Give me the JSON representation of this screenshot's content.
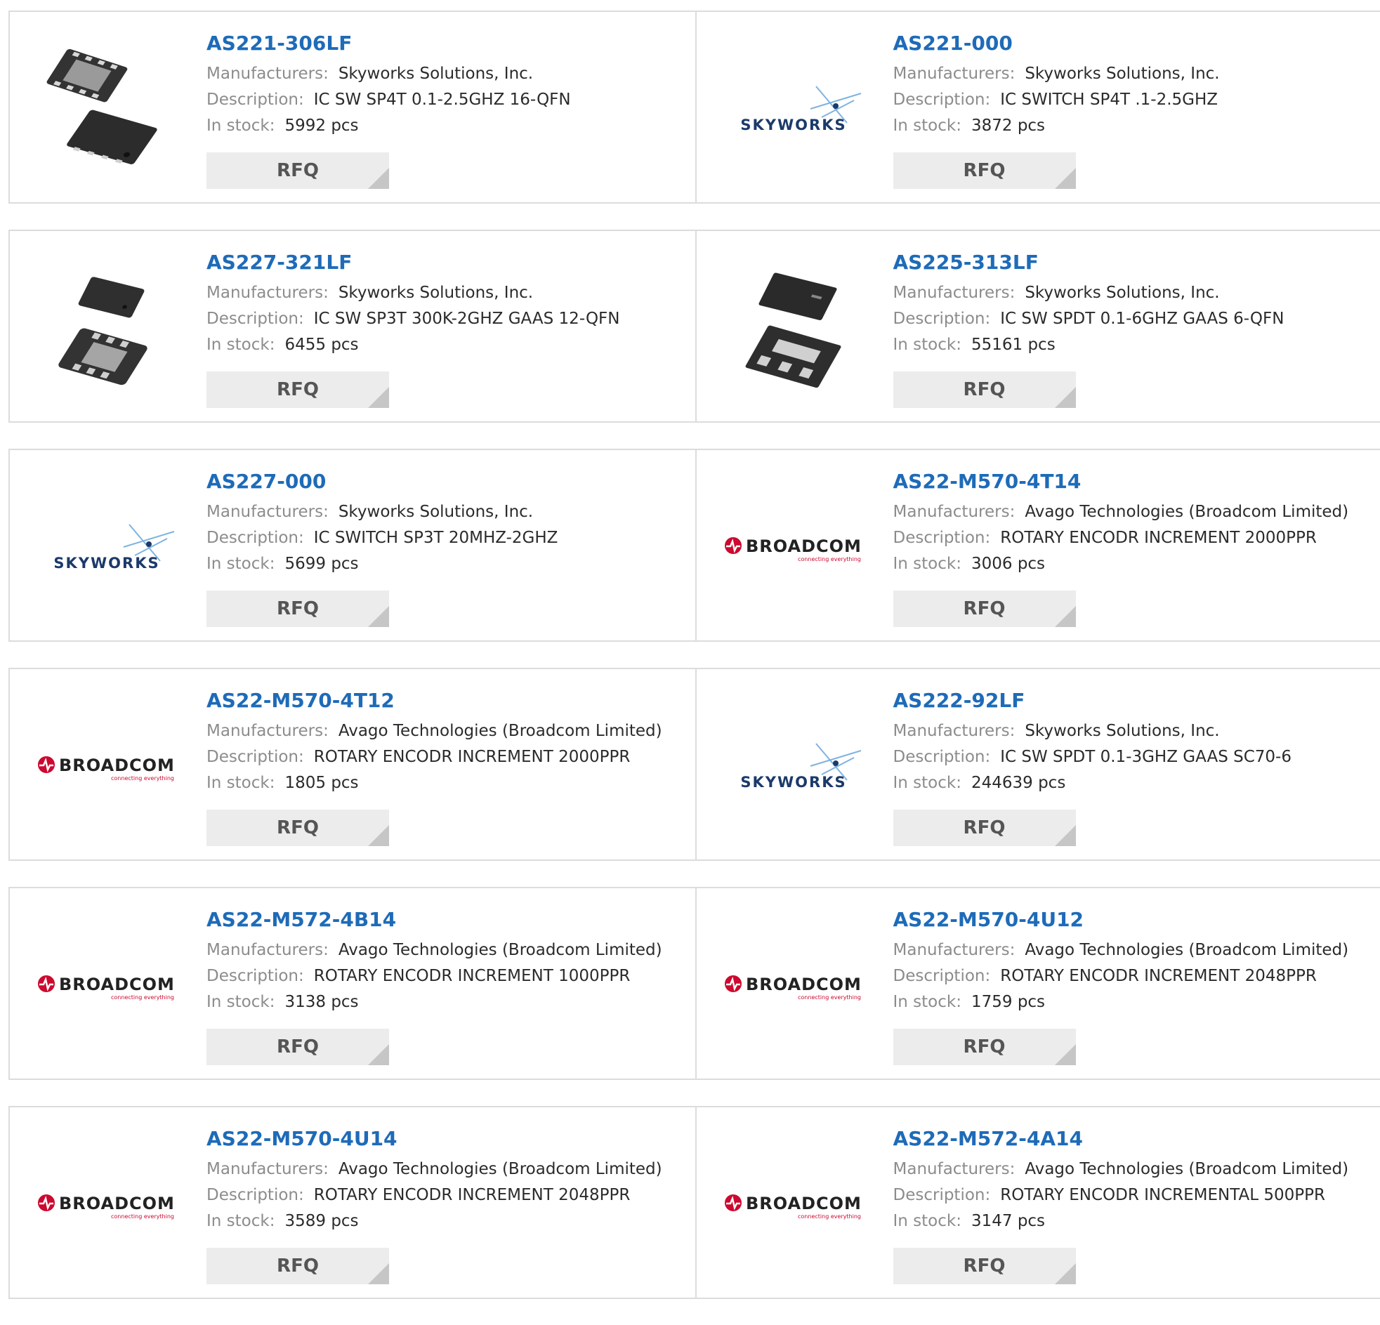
{
  "labels": {
    "manufacturer": "Manufacturers:",
    "description": "Description:",
    "stock": "In stock:",
    "rfq": "RFQ"
  },
  "colors": {
    "part_link": "#1e6bb8",
    "label_gray": "#8c8c8c",
    "button_bg": "#ececec",
    "skyworks_blue": "#1b3a6b",
    "broadcom_red": "#cc092f"
  },
  "products": [
    {
      "part": "AS221-306LF",
      "image": "qfn16-chip",
      "manufacturer": "Skyworks Solutions, Inc.",
      "description": "IC SW SP4T 0.1-2.5GHZ 16-QFN",
      "stock": "5992 pcs"
    },
    {
      "part": "AS221-000",
      "image": "skyworks-logo",
      "logo_text": "SKYWORKS",
      "manufacturer": "Skyworks Solutions, Inc.",
      "description": "IC SWITCH SP4T .1-2.5GHZ",
      "stock": "3872 pcs"
    },
    {
      "part": "AS227-321LF",
      "image": "qfn12-chip",
      "manufacturer": "Skyworks Solutions, Inc.",
      "description": "IC SW SP3T 300K-2GHZ GAAS 12-QFN",
      "stock": "6455 pcs"
    },
    {
      "part": "AS225-313LF",
      "image": "qfn6-chip",
      "manufacturer": "Skyworks Solutions, Inc.",
      "description": "IC SW SPDT 0.1-6GHZ GAAS 6-QFN",
      "stock": "55161 pcs"
    },
    {
      "part": "AS227-000",
      "image": "skyworks-logo",
      "logo_text": "SKYWORKS",
      "manufacturer": "Skyworks Solutions, Inc.",
      "description": "IC SWITCH SP3T 20MHZ-2GHZ",
      "stock": "5699 pcs"
    },
    {
      "part": "AS22-M570-4T14",
      "image": "broadcom-logo",
      "logo_text": "BROADCOM",
      "logo_tagline": "connecting everything",
      "manufacturer": "Avago Technologies (Broadcom Limited)",
      "description": "ROTARY ENCODR INCREMENT 2000PPR",
      "stock": "3006 pcs"
    },
    {
      "part": "AS22-M570-4T12",
      "image": "broadcom-logo",
      "logo_text": "BROADCOM",
      "logo_tagline": "connecting everything",
      "manufacturer": "Avago Technologies (Broadcom Limited)",
      "description": "ROTARY ENCODR INCREMENT 2000PPR",
      "stock": "1805 pcs"
    },
    {
      "part": "AS222-92LF",
      "image": "skyworks-logo",
      "logo_text": "SKYWORKS",
      "manufacturer": "Skyworks Solutions, Inc.",
      "description": "IC SW SPDT 0.1-3GHZ GAAS SC70-6",
      "stock": "244639 pcs"
    },
    {
      "part": "AS22-M572-4B14",
      "image": "broadcom-logo",
      "logo_text": "BROADCOM",
      "logo_tagline": "connecting everything",
      "manufacturer": "Avago Technologies (Broadcom Limited)",
      "description": "ROTARY ENCODR INCREMENT 1000PPR",
      "stock": "3138 pcs"
    },
    {
      "part": "AS22-M570-4U12",
      "image": "broadcom-logo",
      "logo_text": "BROADCOM",
      "logo_tagline": "connecting everything",
      "manufacturer": "Avago Technologies (Broadcom Limited)",
      "description": "ROTARY ENCODR INCREMENT 2048PPR",
      "stock": "1759 pcs"
    },
    {
      "part": "AS22-M570-4U14",
      "image": "broadcom-logo",
      "logo_text": "BROADCOM",
      "logo_tagline": "connecting everything",
      "manufacturer": "Avago Technologies (Broadcom Limited)",
      "description": "ROTARY ENCODR INCREMENT 2048PPR",
      "stock": "3589 pcs"
    },
    {
      "part": "AS22-M572-4A14",
      "image": "broadcom-logo",
      "logo_text": "BROADCOM",
      "logo_tagline": "connecting everything",
      "manufacturer": "Avago Technologies (Broadcom Limited)",
      "description": "ROTARY ENCODR INCREMENTAL 500PPR",
      "stock": "3147 pcs"
    }
  ]
}
